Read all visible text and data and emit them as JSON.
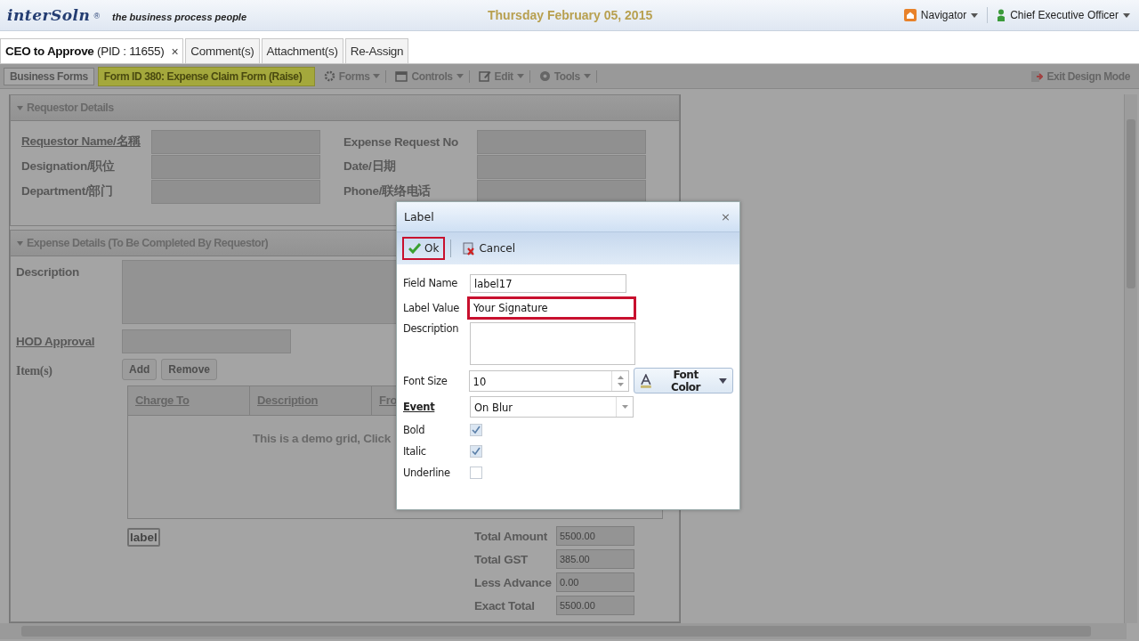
{
  "header": {
    "logo": "interSoln",
    "logo_mark": "®",
    "tagline": "the business process people",
    "date": "Thursday February 05, 2015",
    "navigator": "Navigator",
    "user": "Chief Executive Officer"
  },
  "tabs": [
    {
      "label": "CEO to Approve",
      "suffix": "(PID : 11655)",
      "selected": true,
      "closable": true
    },
    {
      "label": "Comment(s)",
      "selected": false,
      "closable": false
    },
    {
      "label": "Attachment(s)",
      "selected": false,
      "closable": false
    },
    {
      "label": "Re-Assign",
      "selected": false,
      "closable": false
    }
  ],
  "close_glyph": "×",
  "toolbar": {
    "business_forms": "Business Forms",
    "form_title": "Form ID 380: Expense Claim Form (Raise)",
    "menus": [
      {
        "label": "Forms",
        "kind": "forms"
      },
      {
        "label": "Controls",
        "kind": "controls"
      },
      {
        "label": "Edit",
        "kind": "edit"
      },
      {
        "label": "Tools",
        "kind": "tools"
      }
    ],
    "exit": "Exit Design Mode"
  },
  "requestor_details": {
    "title": "Requestor Details",
    "left_fields": [
      {
        "label": "Requestor Name/名稱",
        "underlined": true
      },
      {
        "label": "Designation/职位",
        "underlined": false
      },
      {
        "label": "Department/部门",
        "underlined": false
      }
    ],
    "right_fields": [
      {
        "label": "Expense Request No"
      },
      {
        "label": "Date/日期"
      },
      {
        "label": "Phone/联络电话"
      }
    ]
  },
  "expense_details": {
    "title": "Expense Details (To Be Completed By Requestor)",
    "description_label": "Description",
    "hod_label": "HOD Approval",
    "items_label": "Item(s)",
    "buttons": [
      "Add",
      "Remove"
    ],
    "grid": {
      "columns": [
        "Charge To",
        "Description",
        "Fro"
      ],
      "message": "This is a demo grid, Click"
    },
    "label_control": "label",
    "totals": [
      {
        "label": "Total Amount",
        "value": "5500.00"
      },
      {
        "label": "Total GST",
        "value": "385.00"
      },
      {
        "label": "Less Advance",
        "value": "0.00"
      },
      {
        "label": "Exact Total",
        "value": "5500.00"
      }
    ]
  },
  "dialog": {
    "title": "Label",
    "close": "×",
    "buttons": [
      {
        "label": "Ok",
        "kind": "ok",
        "highlighted": true
      },
      {
        "label": "Cancel",
        "kind": "cancel",
        "highlighted": false
      }
    ],
    "field_name": {
      "label": "Field Name",
      "value": "label17"
    },
    "label_value": {
      "label": "Label Value",
      "value": "Your Signature",
      "highlighted": true
    },
    "description": {
      "label": "Description"
    },
    "font_size": {
      "label": "Font Size",
      "value": "10"
    },
    "font_color": "Font Color",
    "event": {
      "label": "Event",
      "value": "On Blur"
    },
    "checks": [
      {
        "label": "Bold",
        "checked": true
      },
      {
        "label": "Italic",
        "checked": true
      },
      {
        "label": "Underline",
        "checked": false
      }
    ]
  }
}
